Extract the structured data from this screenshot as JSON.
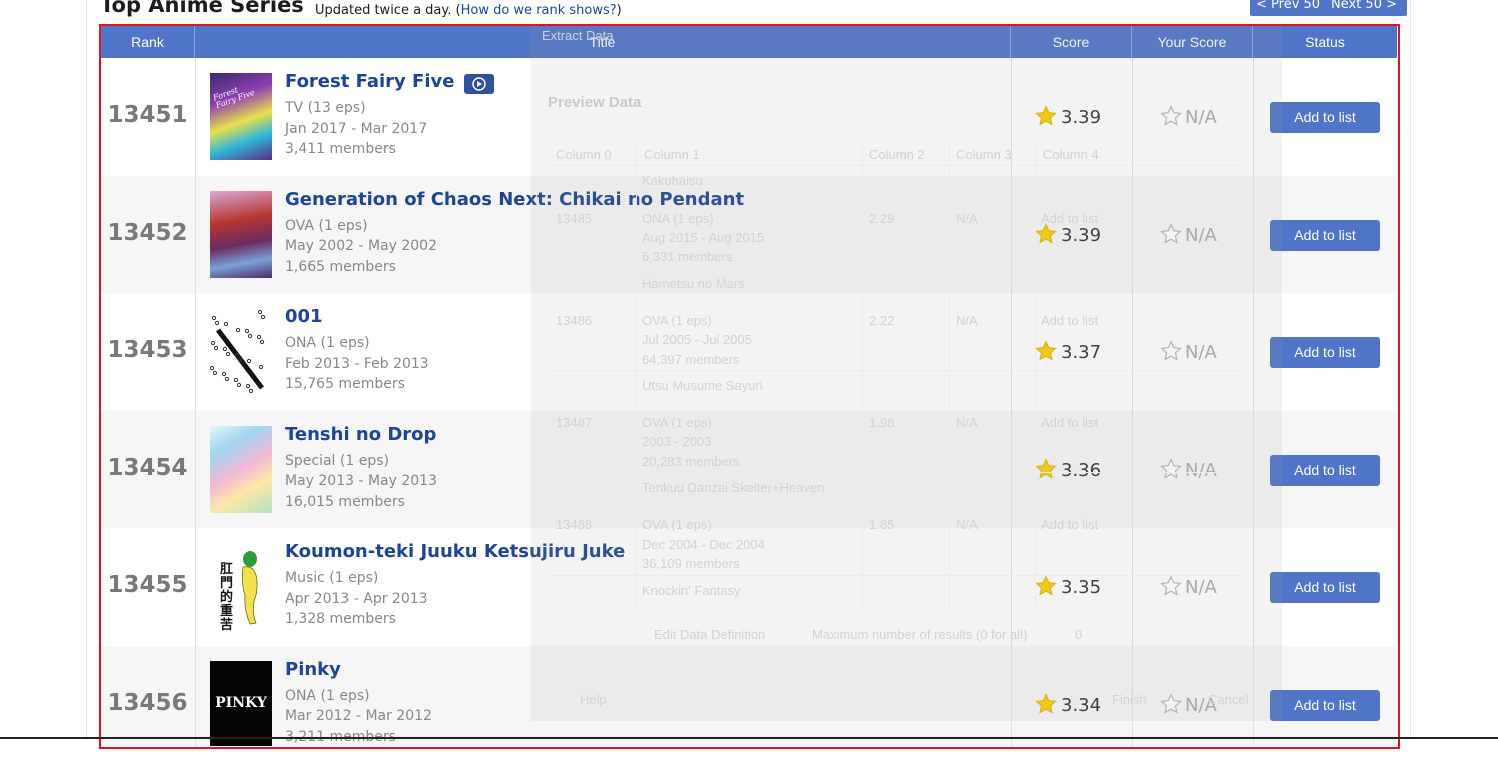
{
  "page": {
    "heading": "Top Anime Series",
    "updated_text": "Updated twice a day.",
    "rank_link": "How do we rank shows?",
    "prev_label": "< Prev 50",
    "next_label": "Next 50 >"
  },
  "table": {
    "headers": [
      "Rank",
      "Title",
      "Score",
      "Your Score",
      "Status"
    ],
    "add_label": "Add to list",
    "rows": [
      {
        "rank": "13451",
        "title": "Forest Fairy Five",
        "type": "TV (13 eps)",
        "dates": "Jan 2017 - Mar 2017",
        "members": "3,411 members",
        "score": "3.39",
        "your_score": "N/A",
        "has_watch_icon": true
      },
      {
        "rank": "13452",
        "title": "Generation of Chaos Next: Chikai no Pendant",
        "type": "OVA (1 eps)",
        "dates": "May 2002 - May 2002",
        "members": "1,665 members",
        "score": "3.39",
        "your_score": "N/A",
        "has_watch_icon": false
      },
      {
        "rank": "13453",
        "title": "001",
        "type": "ONA (1 eps)",
        "dates": "Feb 2013 - Feb 2013",
        "members": "15,765 members",
        "score": "3.37",
        "your_score": "N/A",
        "has_watch_icon": false
      },
      {
        "rank": "13454",
        "title": "Tenshi no Drop",
        "type": "Special (1 eps)",
        "dates": "May 2013 - May 2013",
        "members": "16,015 members",
        "score": "3.36",
        "your_score": "N/A",
        "has_watch_icon": false
      },
      {
        "rank": "13455",
        "title": "Koumon-teki Juuku Ketsujiru Juke",
        "type": "Music (1 eps)",
        "dates": "Apr 2013 - Apr 2013",
        "members": "1,328 members",
        "score": "3.35",
        "your_score": "N/A",
        "has_watch_icon": false
      },
      {
        "rank": "13456",
        "title": "Pinky",
        "type": "ONA (1 eps)",
        "dates": "Mar 2012 - Mar 2012",
        "members": "3,211 members",
        "score": "3.34",
        "your_score": "N/A",
        "has_watch_icon": false
      }
    ]
  },
  "thumb_text": {
    "row1": "Forest Fairy Five",
    "row5": "肛門的重苦",
    "row6": "PINKY"
  },
  "overlay": {
    "label": "Extract Data",
    "title": "Preview Data",
    "columns": [
      "Column 0",
      "Column 1",
      "Column 2",
      "Column 3",
      "Column 4"
    ],
    "rows": [
      {
        "c0": "",
        "c1": "Kakuhaisu",
        "c2": "",
        "c3": "",
        "c4": ""
      },
      {
        "c0": "13485",
        "c1": "ONA (1 eps)",
        "c2": "2.29",
        "c3": "N/A",
        "c4": "Add to list"
      },
      {
        "c0": "",
        "c1": "Aug 2015 - Aug 2015",
        "c2": "",
        "c3": "",
        "c4": ""
      },
      {
        "c0": "",
        "c1": "6,331 members",
        "c2": "",
        "c3": "",
        "c4": ""
      },
      {
        "c0": "",
        "c1": "Hametsu no Mars",
        "c2": "",
        "c3": "",
        "c4": ""
      },
      {
        "c0": "13486",
        "c1": "OVA (1 eps)",
        "c2": "2.22",
        "c3": "N/A",
        "c4": "Add to list"
      },
      {
        "c0": "",
        "c1": "Jul 2005 - Jul 2005",
        "c2": "",
        "c3": "",
        "c4": ""
      },
      {
        "c0": "",
        "c1": "64,397 members",
        "c2": "",
        "c3": "",
        "c4": ""
      },
      {
        "c0": "",
        "c1": "Utsu Musume Sayuri",
        "c2": "",
        "c3": "",
        "c4": ""
      },
      {
        "c0": "13487",
        "c1": "OVA (1 eps)",
        "c2": "1.98",
        "c3": "N/A",
        "c4": "Add to list"
      },
      {
        "c0": "",
        "c1": "2003 - 2003",
        "c2": "",
        "c3": "",
        "c4": ""
      },
      {
        "c0": "",
        "c1": "20,283 members",
        "c2": "",
        "c3": "",
        "c4": ""
      },
      {
        "c0": "",
        "c1": "Tenkuu Danzai Skelter+Heaven",
        "c2": "",
        "c3": "",
        "c4": ""
      },
      {
        "c0": "13488",
        "c1": "OVA (1 eps)",
        "c2": "1.85",
        "c3": "N/A",
        "c4": "Add to list"
      },
      {
        "c0": "",
        "c1": "Dec 2004 - Dec 2004",
        "c2": "",
        "c3": "",
        "c4": ""
      },
      {
        "c0": "",
        "c1": "36,109 members",
        "c2": "",
        "c3": "",
        "c4": ""
      },
      {
        "c0": "",
        "c1": "Knockin' Fantasy",
        "c2": "",
        "c3": "",
        "c4": ""
      }
    ],
    "edit_label": "Edit Data Definition",
    "max_label": "Maximum number of results (0 for all)",
    "max_value": "0",
    "help_label": "Help",
    "finish_label": "Finish",
    "cancel_label": "Cancel"
  },
  "colors": {
    "header_bg": "#4f74c8",
    "title_link": "#1d439b",
    "selection_border": "#e0141e",
    "star": "#f8d200"
  },
  "icons": [
    "play-circle-icon",
    "star-filled-icon",
    "star-outline-icon"
  ]
}
